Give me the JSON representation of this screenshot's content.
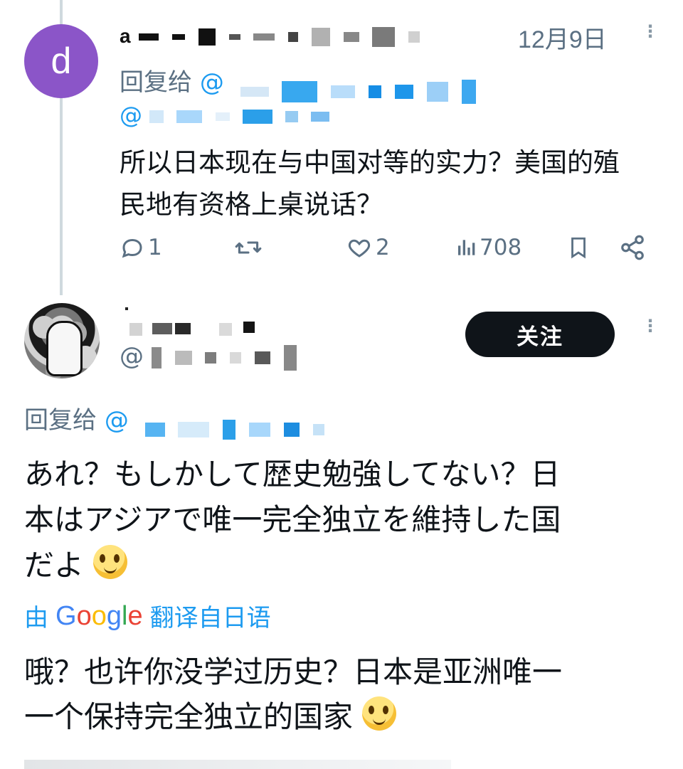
{
  "tweet1": {
    "avatar_initial": "d",
    "date": "12月9日",
    "reply_label": "回复给",
    "handle_prefix": "@",
    "handle_line2_prefix": "@",
    "text_line1": "所以日本现在与中国对等的实力？美国的殖",
    "text_line2": "民地有资格上桌说话？",
    "actions": {
      "reply_count": "1",
      "like_count": "2",
      "view_count": "708"
    }
  },
  "tweet2": {
    "follow_label": "关注",
    "handle_prefix": "@",
    "reply_label": "回复给",
    "reply_handle_prefix": "@",
    "jp_line1": "あれ？もしかして歴史勉強してない？日",
    "jp_line2": "本はアジアで唯一完全独立を維持した国",
    "jp_line3": "だよ",
    "translation_prefix": "由",
    "translation_suffix": "翻译自日语",
    "zh_line1": "哦？也许你没学过历史？日本是亚洲唯一",
    "zh_line2": "一个保持完全独立的国家"
  },
  "colors": {
    "link": "#1d9bf0",
    "muted": "#5b7083",
    "text": "#0f1419",
    "thread_line": "#cfd9de",
    "avatar_purple": "#8b55c8",
    "follow_bg": "#0f1419"
  },
  "icons": {
    "reply": "reply-icon",
    "retweet": "retweet-icon",
    "like": "heart-icon",
    "views": "views-icon",
    "bookmark": "bookmark-icon",
    "share": "share-icon",
    "more": "more-vertical-icon",
    "emoji": "pleading-face-emoji"
  }
}
